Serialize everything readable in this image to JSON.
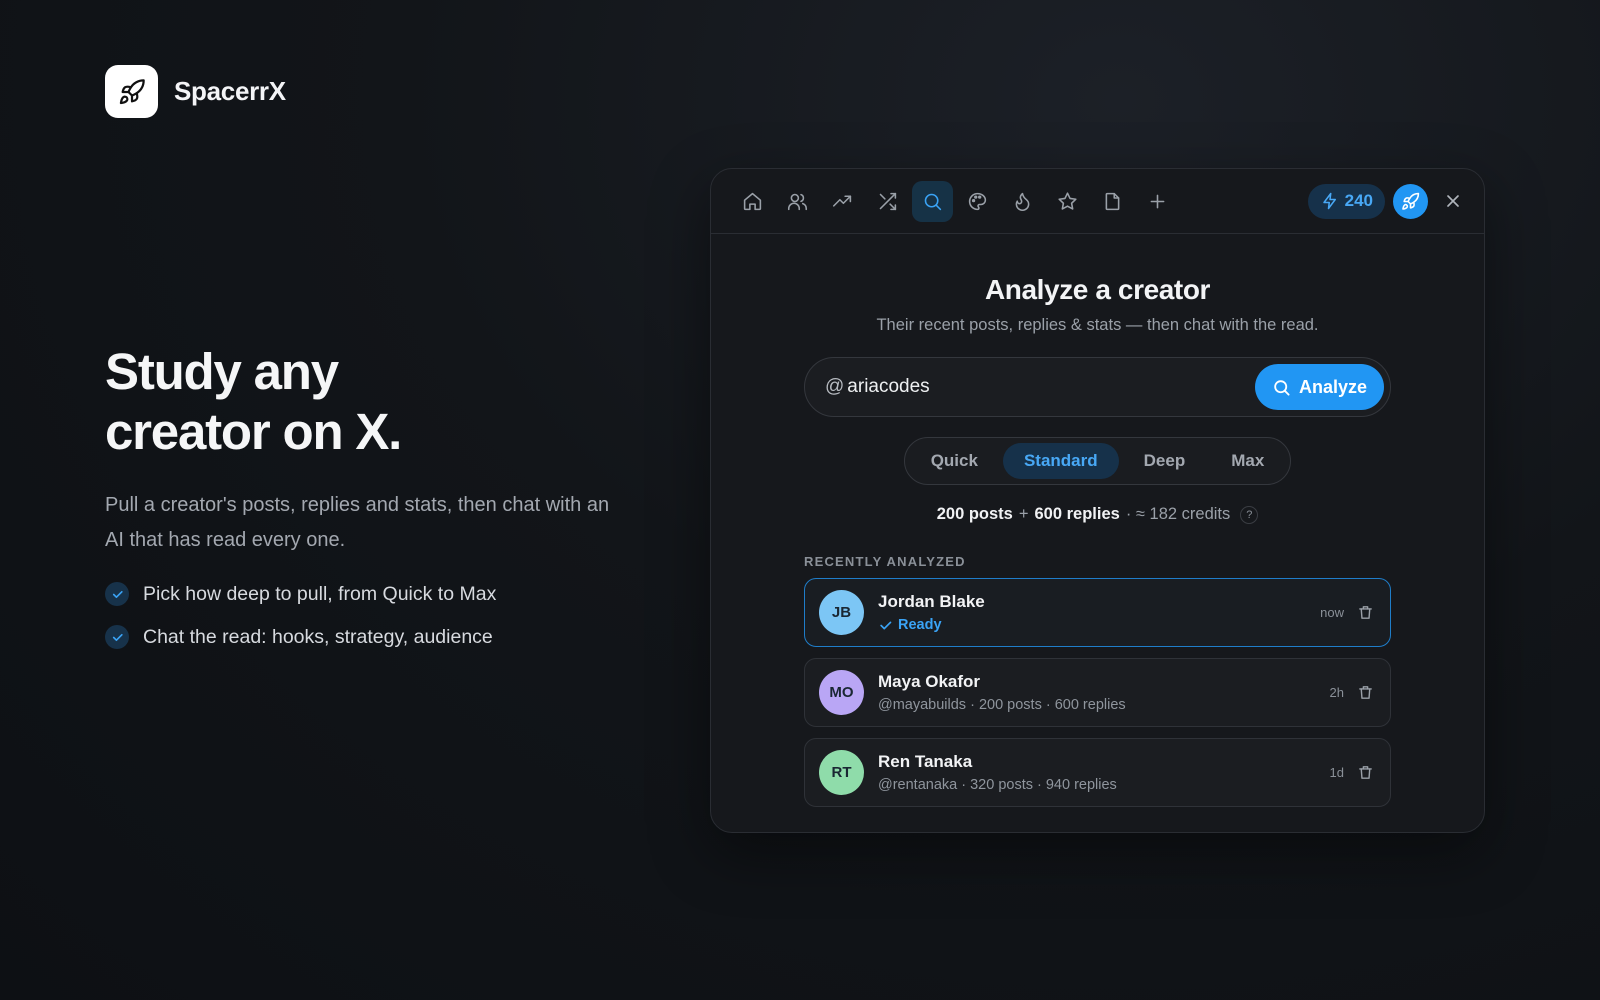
{
  "brand": {
    "name": "SpacerrX",
    "logo_icon": "rocket-icon"
  },
  "hero": {
    "title_line1": "Study any",
    "title_line2": "creator on X.",
    "description": "Pull a creator's posts, replies and stats, then chat with an AI that has read every one.",
    "features": [
      "Pick how deep to pull, from Quick to Max",
      "Chat the read: hooks, strategy, audience"
    ]
  },
  "toolbar": {
    "icons": [
      "home-icon",
      "users-icon",
      "trending-icon",
      "shuffle-icon",
      "search-icon",
      "palette-icon",
      "flame-icon",
      "star-icon",
      "file-icon",
      "plus-icon"
    ],
    "active": "search-icon",
    "credits": "240"
  },
  "analyze": {
    "title": "Analyze a creator",
    "subtitle": "Their recent posts, replies & stats — then chat with the read.",
    "at_prefix": "@",
    "input_value": "ariacodes",
    "button_label": "Analyze"
  },
  "depth": {
    "options": [
      "Quick",
      "Standard",
      "Deep",
      "Max"
    ],
    "selected": "Standard"
  },
  "estimate": {
    "posts": "200 posts",
    "plus": "+",
    "replies": "600 replies",
    "credits": "· ≈ 182 credits",
    "help": "?"
  },
  "recent": {
    "label": "RECENTLY ANALYZED",
    "items": [
      {
        "initials": "JB",
        "name": "Jordan Blake",
        "meta": "Ready",
        "time": "now",
        "avatar_color": "#7cc6f5",
        "status": "ready"
      },
      {
        "initials": "MO",
        "name": "Maya Okafor",
        "meta": "@mayabuilds · 200 posts · 600 replies",
        "time": "2h",
        "avatar_color": "#b9a6f5",
        "status": "done"
      },
      {
        "initials": "RT",
        "name": "Ren Tanaka",
        "meta": "@rentanaka · 320 posts · 940 replies",
        "time": "1d",
        "avatar_color": "#8fdcaa",
        "status": "done"
      }
    ]
  },
  "colors": {
    "accent": "#2196f3",
    "accent_soft": "#16314a",
    "panel_bg": "#16181c"
  }
}
